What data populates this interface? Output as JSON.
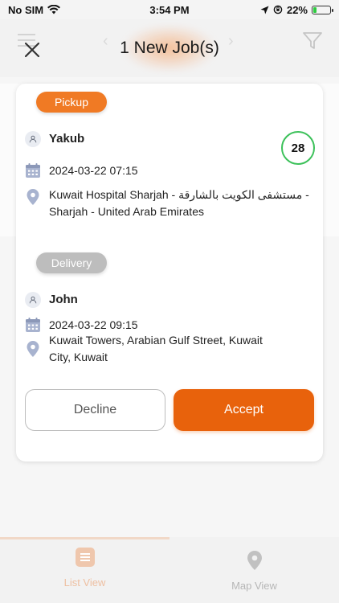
{
  "status_bar": {
    "carrier": "No SIM",
    "time": "3:54 PM",
    "battery": "22%",
    "battery_level": 0.22
  },
  "header": {
    "title": "1 New Job(s)"
  },
  "job": {
    "count": "28",
    "pickup": {
      "label": "Pickup",
      "name": "Yakub",
      "datetime": "2024-03-22 07:15",
      "address": "Kuwait Hospital Sharjah - مستشفى الكويت بالشارقة - Sharjah - United Arab Emirates"
    },
    "delivery": {
      "label": "Delivery",
      "name": "John",
      "datetime": "2024-03-22 09:15",
      "address": "Kuwait Towers, Arabian Gulf Street, Kuwait City, Kuwait"
    },
    "decline_label": "Decline",
    "accept_label": "Accept"
  },
  "bottom_nav": {
    "list_view": "List View",
    "map_view": "Map View"
  },
  "colors": {
    "accent": "#e8620c",
    "pickup_badge": "#f07a24",
    "delivery_badge": "#bdbdbd",
    "count_ring": "#3cc15a"
  }
}
